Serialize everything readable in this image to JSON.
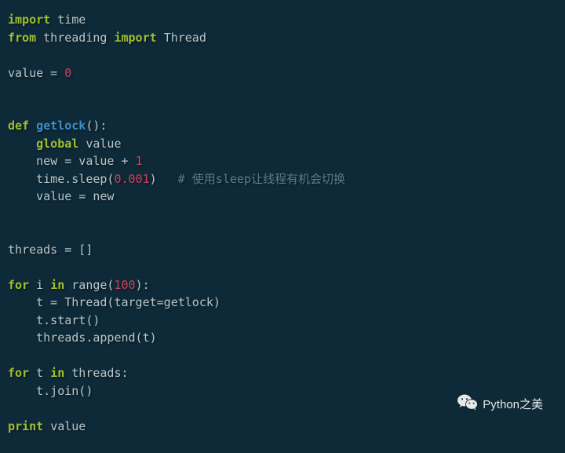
{
  "code": {
    "l1": {
      "kw_import": "import",
      "mod_time": "time"
    },
    "l2": {
      "kw_from": "from",
      "mod_threading": "threading",
      "kw_import": "import",
      "cls_thread": "Thread"
    },
    "l4": {
      "var_value": "value",
      "eq": " = ",
      "num_zero": "0"
    },
    "l7": {
      "kw_def": "def",
      "fn_name": "getlock",
      "parens": "():"
    },
    "l8": {
      "indent": "    ",
      "kw_global": "global",
      "var_value": " value"
    },
    "l9": {
      "indent": "    ",
      "lhs": "new = value + ",
      "num_one": "1"
    },
    "l10": {
      "indent": "    ",
      "call": "time.sleep(",
      "num": "0.001",
      "close": ")",
      "gap": "   ",
      "comment": "# 使用sleep让线程有机会切换"
    },
    "l11": {
      "indent": "    ",
      "stmt": "value = new"
    },
    "l14": {
      "stmt": "threads = []"
    },
    "l16": {
      "kw_for": "for",
      "mid": " i ",
      "kw_in": "in",
      "rng": " range(",
      "num": "100",
      "end": "):"
    },
    "l17": {
      "indent": "    ",
      "stmt": "t = Thread(target=getlock)"
    },
    "l18": {
      "indent": "    ",
      "stmt": "t.start()"
    },
    "l19": {
      "indent": "    ",
      "stmt": "threads.append(t)"
    },
    "l21": {
      "kw_for": "for",
      "mid": " t ",
      "kw_in": "in",
      "rest": " threads:"
    },
    "l22": {
      "indent": "    ",
      "stmt": "t.join()"
    },
    "l24": {
      "kw_print": "print",
      "sp": " ",
      "var": "value"
    }
  },
  "watermark": {
    "text": "Python之美"
  }
}
